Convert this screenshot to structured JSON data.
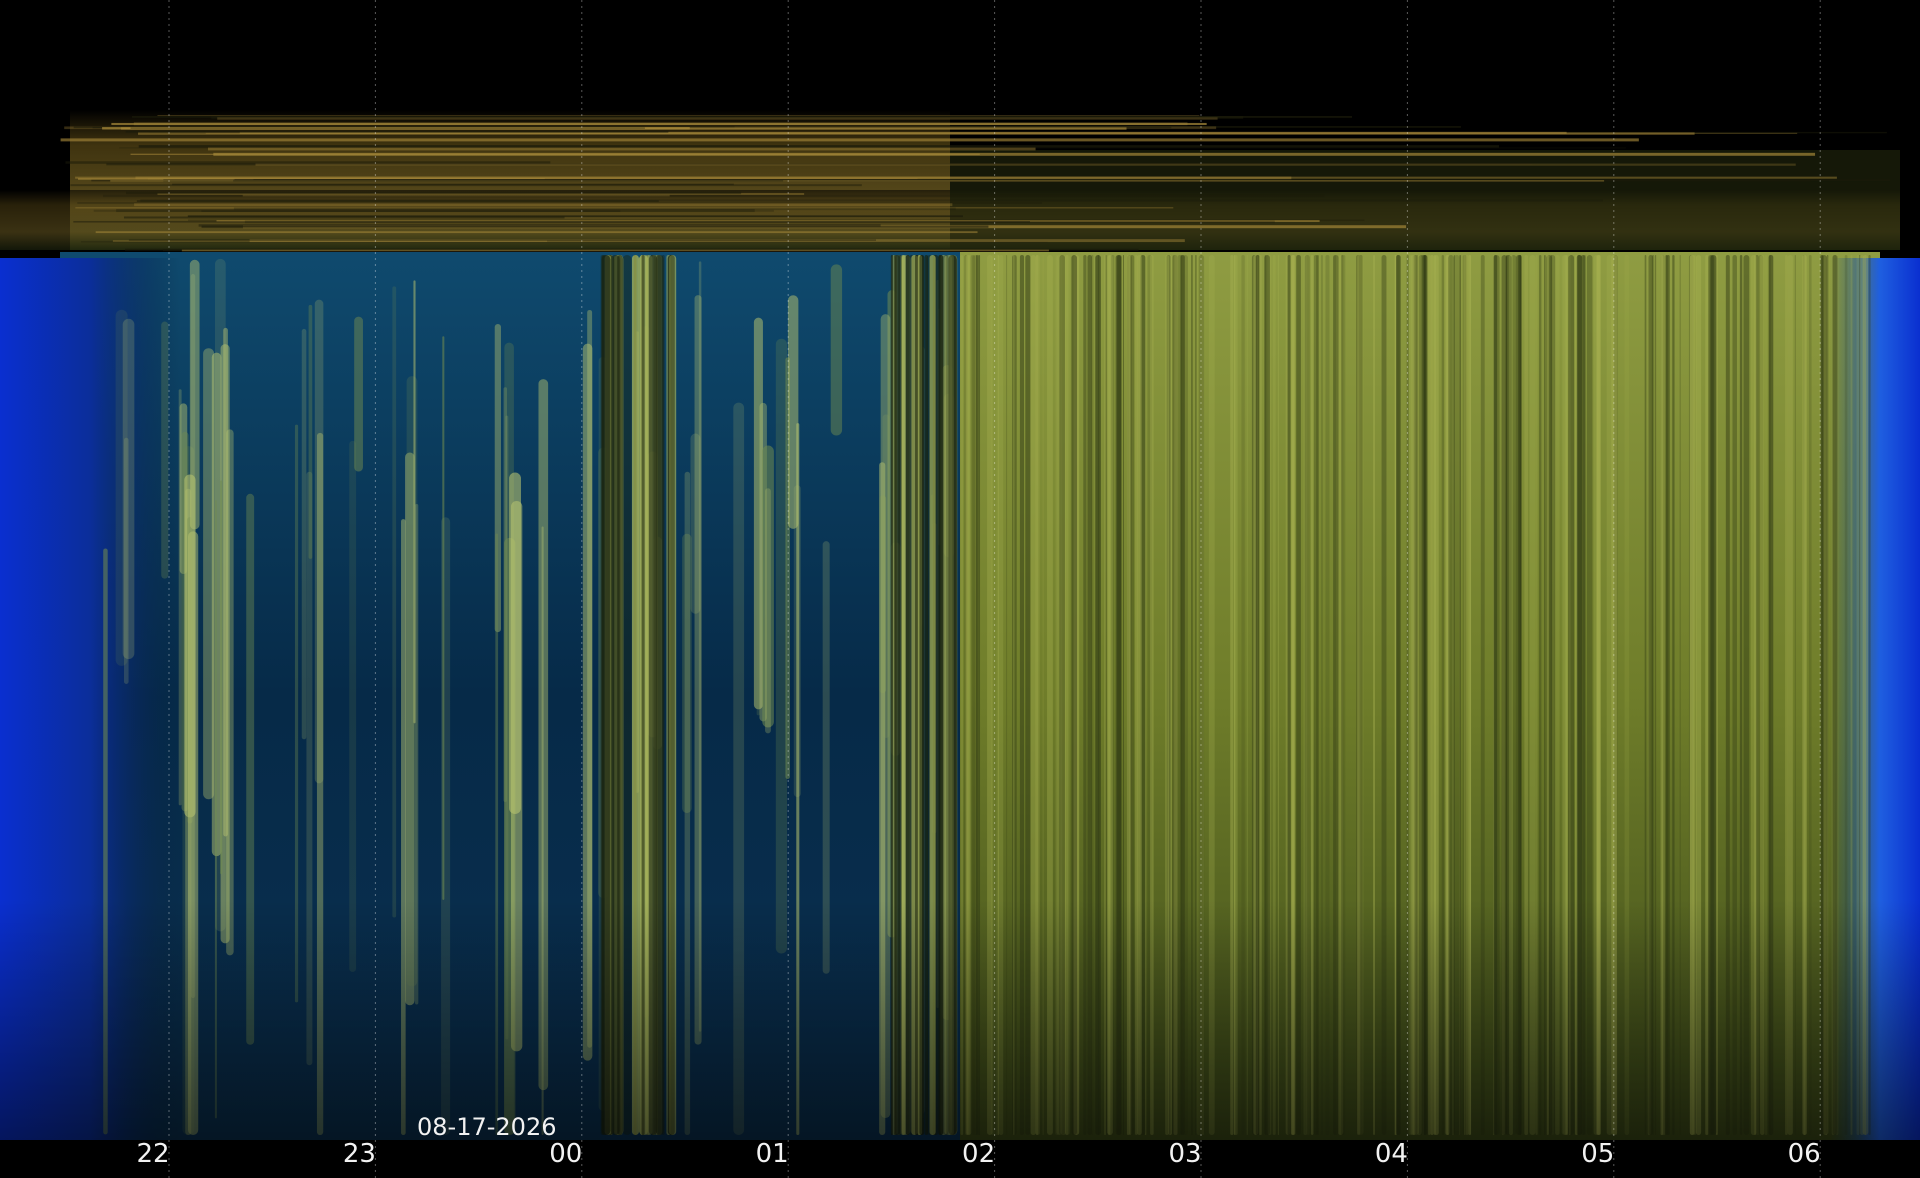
{
  "chart_data": {
    "type": "heatmap",
    "title": "",
    "xlabel": "",
    "ylabel": "",
    "x_ticks": [
      "22",
      "23",
      "00",
      "01",
      "02",
      "03",
      "04",
      "05",
      "06"
    ],
    "date_label": "08-17-2026",
    "grid": true,
    "colors": {
      "background": "#000000",
      "twilight_blue": "#0a2fd0",
      "night_sky": "#06203a",
      "cloud_green": "#8c9a3c",
      "haze_band": "#6a5a22",
      "label": "#f2f2f2"
    }
  }
}
